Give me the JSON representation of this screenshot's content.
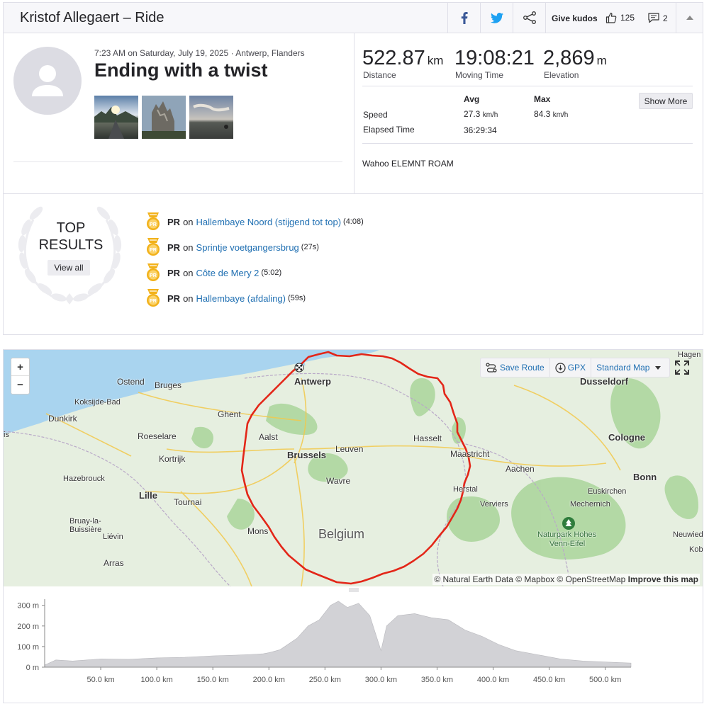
{
  "header": {
    "title": "Kristof Allegaert – Ride",
    "give_kudos": "Give kudos",
    "kudos_count": "125",
    "comments_count": "2"
  },
  "activity": {
    "meta": "7:23 AM on Saturday, July 19, 2025 · Antwerp, Flanders",
    "name": "Ending with a twist",
    "device": "Wahoo ELEMNT ROAM"
  },
  "stats": {
    "distance": {
      "value": "522.87",
      "unit": "km",
      "label": "Distance"
    },
    "moving_time": {
      "value": "19:08:21",
      "label": "Moving Time"
    },
    "elevation": {
      "value": "2,869",
      "unit": "m",
      "label": "Elevation"
    },
    "table": {
      "avg_header": "Avg",
      "max_header": "Max",
      "speed_label": "Speed",
      "speed_avg": "27.3",
      "speed_max": "84.3",
      "speed_unit": "km/h",
      "elapsed_label": "Elapsed Time",
      "elapsed_avg": "36:29:34"
    },
    "show_more": "Show More"
  },
  "top_results": {
    "title_line1": "TOP",
    "title_line2": "RESULTS",
    "view_all": "View all",
    "items": [
      {
        "badge": "PR",
        "on": "on",
        "segment": "Hallembaye Noord (stijgend tot top)",
        "time": "(4:08)"
      },
      {
        "badge": "PR",
        "on": "on",
        "segment": "Sprintje voetgangersbrug",
        "time": "(27s)"
      },
      {
        "badge": "PR",
        "on": "on",
        "segment": "Côte de Mery 2",
        "time": "(5:02)"
      },
      {
        "badge": "PR",
        "on": "on",
        "segment": "Hallembaye (afdaling)",
        "time": "(59s)"
      }
    ]
  },
  "map": {
    "save_route": "Save Route",
    "gpx": "GPX",
    "map_style": "Standard Map",
    "attribution": "© Natural Earth Data © Mapbox © OpenStreetMap",
    "improve": "Improve this map",
    "labels": {
      "antwerp": "Antwerp",
      "ostend": "Ostend",
      "bruges": "Bruges",
      "koksijde": "Koksijde-Bad",
      "dunkirk": "Dunkirk",
      "ghent": "Ghent",
      "roeselare": "Roeselare",
      "aalst": "Aalst",
      "brussels": "Brussels",
      "leuven": "Leuven",
      "hasselt": "Hasselt",
      "maastricht": "Maastricht",
      "kortrijk": "Kortrijk",
      "hazebrouck": "Hazebrouck",
      "lille": "Lille",
      "tournai": "Tournai",
      "wavre": "Wavre",
      "aachen": "Aachen",
      "herstal": "Herstal",
      "verviers": "Verviers",
      "bruay": "Bruay-la-",
      "bruay2": "Buissière",
      "lievin": "Liévin",
      "mons": "Mons",
      "belgium": "Belgium",
      "arras": "Arras",
      "dusseldorf": "Dusseldorf",
      "cologne": "Cologne",
      "bonn": "Bonn",
      "euskirchen": "Euskirchen",
      "mechernich": "Mechernich",
      "naturpark1": "Naturpark Hohes",
      "naturpark2": "Venn-Eifel",
      "hagen": "Hagen",
      "neuwied": "Neuwied",
      "kob": "Kob",
      "is": "is"
    }
  },
  "elevation_chart": {
    "y_ticks": [
      "300 m",
      "200 m",
      "100 m",
      "0 m"
    ],
    "x_ticks": [
      "50.0 km",
      "100.0 km",
      "150.0 km",
      "200.0 km",
      "250.0 km",
      "300.0 km",
      "350.0 km",
      "400.0 km",
      "450.0 km",
      "500.0 km"
    ]
  },
  "chart_data": {
    "type": "area",
    "title": "",
    "xlabel": "",
    "ylabel": "",
    "xlim": [
      0,
      523
    ],
    "ylim": [
      0,
      330
    ],
    "x": [
      0,
      10,
      25,
      50,
      75,
      100,
      125,
      150,
      170,
      185,
      195,
      200,
      210,
      225,
      235,
      245,
      255,
      262,
      270,
      280,
      290,
      300,
      305,
      315,
      330,
      345,
      360,
      375,
      390,
      405,
      420,
      440,
      460,
      480,
      500,
      523
    ],
    "series": [
      {
        "values": [
          10,
          35,
          30,
          40,
          38,
          45,
          48,
          55,
          58,
          62,
          65,
          70,
          85,
          140,
          200,
          230,
          300,
          320,
          290,
          310,
          250,
          80,
          200,
          250,
          260,
          240,
          230,
          180,
          150,
          110,
          80,
          60,
          40,
          30,
          25,
          20
        ]
      }
    ],
    "colors": {
      "fill": "#d2d2d6",
      "stroke": "#b8b8bd"
    }
  },
  "colors": {
    "route": "#e32618",
    "link": "#1f6fb2",
    "pr_badge": "#f2b21b",
    "water": "#a7d3ef",
    "land": "#e5efe1",
    "forest": "#9ed28e"
  }
}
